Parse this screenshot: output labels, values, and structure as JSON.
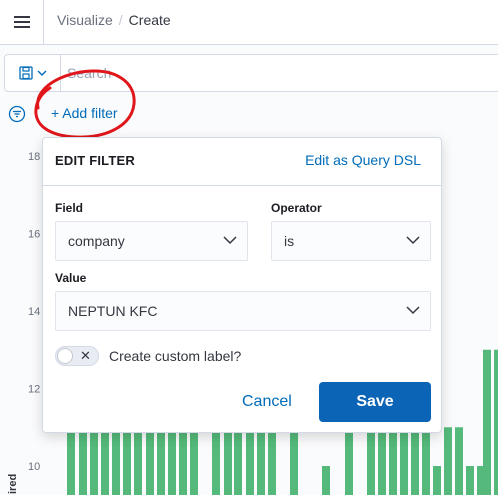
{
  "header": {
    "breadcrumbs": [
      "Visualize",
      "Create"
    ],
    "breadcrumb_separator": "/"
  },
  "querybar": {
    "search_placeholder": "Search"
  },
  "filterbar": {
    "add_filter_label": "+ Add filter"
  },
  "edit_filter": {
    "title": "EDIT FILTER",
    "dsl_link": "Edit as Query DSL",
    "field_label": "Field",
    "field_value": "company",
    "operator_label": "Operator",
    "operator_value": "is",
    "value_label": "Value",
    "value_value": "NEPTUN KFC",
    "custom_label_text": "Create custom label?",
    "custom_label_enabled": false,
    "cancel_label": "Cancel",
    "save_label": "Save"
  },
  "chart_data": {
    "type": "bar",
    "color": "#54b97a",
    "y_ticks": [
      10,
      12,
      14,
      16,
      18
    ],
    "ylim": [
      8.8,
      18.2
    ],
    "ylabel": "ired",
    "bars_visible": [
      {
        "x": 67,
        "v": 11
      },
      {
        "x": 79,
        "v": 11
      },
      {
        "x": 90,
        "v": 11
      },
      {
        "x": 101,
        "v": 11
      },
      {
        "x": 112,
        "v": 11
      },
      {
        "x": 123,
        "v": 11
      },
      {
        "x": 134,
        "v": 11
      },
      {
        "x": 146,
        "v": 11
      },
      {
        "x": 157,
        "v": 11
      },
      {
        "x": 168,
        "v": 11
      },
      {
        "x": 179,
        "v": 11
      },
      {
        "x": 190,
        "v": 11
      },
      {
        "x": 212,
        "v": 11
      },
      {
        "x": 224,
        "v": 11
      },
      {
        "x": 234,
        "v": 11
      },
      {
        "x": 246,
        "v": 11
      },
      {
        "x": 257,
        "v": 11
      },
      {
        "x": 268,
        "v": 11
      },
      {
        "x": 290,
        "v": 11
      },
      {
        "x": 322,
        "v": 10
      },
      {
        "x": 345,
        "v": 11
      },
      {
        "x": 367,
        "v": 11
      },
      {
        "x": 378,
        "v": 11
      },
      {
        "x": 389,
        "v": 11
      },
      {
        "x": 400,
        "v": 11
      },
      {
        "x": 411,
        "v": 11
      },
      {
        "x": 422,
        "v": 11
      },
      {
        "x": 433,
        "v": 10
      },
      {
        "x": 444,
        "v": 11
      },
      {
        "x": 455,
        "v": 11
      },
      {
        "x": 466,
        "v": 10
      },
      {
        "x": 477,
        "v": 10
      },
      {
        "x": 483,
        "v": 13
      },
      {
        "x": 494,
        "v": 13
      }
    ]
  }
}
